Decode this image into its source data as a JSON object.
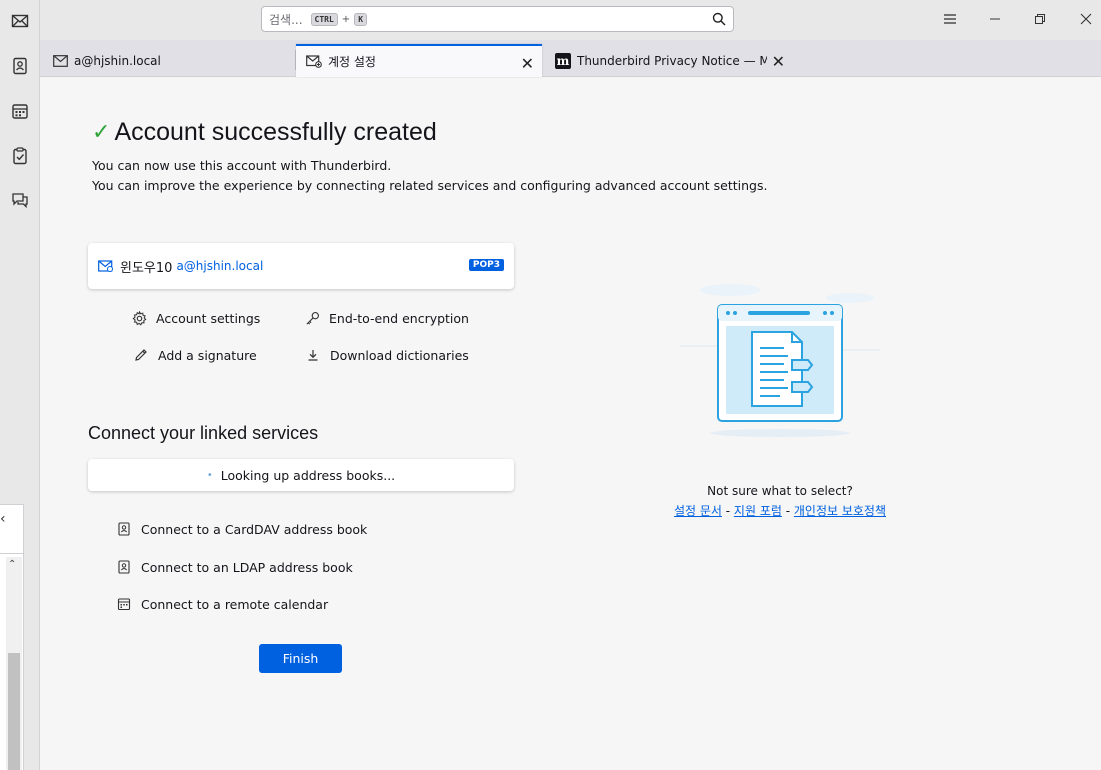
{
  "spaces": [
    {
      "name": "mail",
      "icon": "envelope-icon"
    },
    {
      "name": "address-book",
      "icon": "address-book-icon"
    },
    {
      "name": "calendar",
      "icon": "calendar-icon"
    },
    {
      "name": "tasks",
      "icon": "tasks-icon"
    },
    {
      "name": "chat",
      "icon": "chat-icon"
    }
  ],
  "search": {
    "placeholder": "검색...",
    "shortcut_key1": "CTRL",
    "shortcut_plus": "+",
    "shortcut_key2": "K"
  },
  "tabs": [
    {
      "label": "a@hjshin.local",
      "icon": "envelope-icon",
      "active": false
    },
    {
      "label": "계정 설정",
      "icon": "account-setup-icon",
      "active": true,
      "close": "✕"
    },
    {
      "label": "Thunderbird Privacy Notice — Mozilla",
      "icon": "mozilla-m-icon",
      "active": false,
      "close": "✕"
    }
  ],
  "main": {
    "title": "Account successfully created",
    "desc1": "You can now use this account with Thunderbird.",
    "desc2": "You can improve the experience by connecting related services and configuring advanced account settings.",
    "account": {
      "name": "윈도우10",
      "email": "a@hjshin.local",
      "badge": "POP3"
    },
    "actions": {
      "account_settings": "Account settings",
      "e2e": "End-to-end encryption",
      "signature": "Add a signature",
      "dictionaries": "Download dictionaries"
    },
    "linked_title": "Connect your linked services",
    "lookup": "Looking up address books...",
    "connect": {
      "carddav": "Connect to a CardDAV address book",
      "ldap": "Connect to an LDAP address book",
      "calendar": "Connect to a remote calendar"
    },
    "finish": "Finish"
  },
  "help": {
    "question": "Not sure what to select?",
    "link1": "설정 문서",
    "sep": " - ",
    "link2": "지원 포럼",
    "link3": "개인정보 보호정책"
  },
  "colors": {
    "accent": "#0061e0",
    "success": "#2ea43a"
  }
}
